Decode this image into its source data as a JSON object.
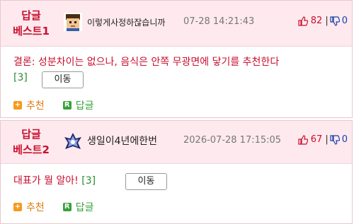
{
  "comments": [
    {
      "badge_line1": "답글",
      "badge_line2": "베스트1",
      "nickname": "이렇게사정하잖습니까",
      "date": "07-28 14:21:43",
      "up_count": "82",
      "down_count": "0",
      "content": "결론: 성분차이는 없으나, 음식은 안쪽 무광면에 닿기를 추천한다",
      "comment_count": "[3]",
      "move_label": "이동",
      "recommend_label": "추천",
      "reply_label": "답글"
    },
    {
      "badge_line1": "답글",
      "badge_line2": "베스트2",
      "nickname": "생일이4년에한번",
      "date": "2026-07-28 17:15:05",
      "up_count": "67",
      "down_count": "0",
      "content": "대표가 뭘 알아!",
      "comment_count": "[3]",
      "move_label": "이동",
      "recommend_label": "추천",
      "reply_label": "답글"
    }
  ],
  "icons": {
    "recommend": "plus-icon",
    "reply": "reply-icon",
    "up": "thumbs-up-icon",
    "down": "thumbs-down-icon"
  },
  "colors": {
    "accent_red": "#c8102e",
    "header_bg": "#fde9ee",
    "recommend_orange": "#f59a1a",
    "reply_green": "#3aa03a",
    "down_blue": "#1a3fa8"
  }
}
